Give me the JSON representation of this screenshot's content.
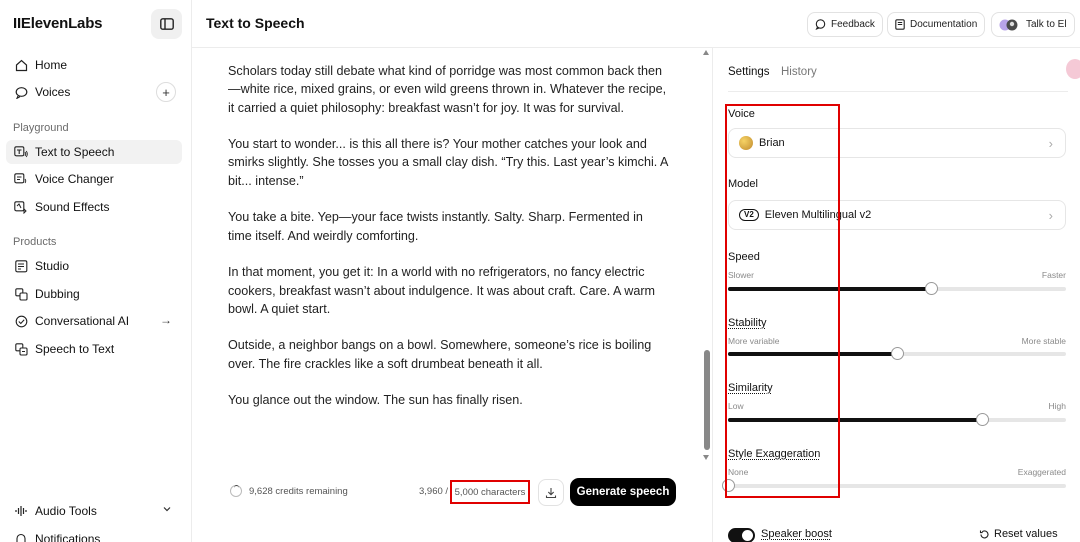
{
  "sidebar": {
    "logo": "IIElevenLabs",
    "nav_top": [
      {
        "label": "Home",
        "icon": "home-icon"
      },
      {
        "label": "Voices",
        "icon": "voices-icon"
      }
    ],
    "section_playground": "Playground",
    "playground": [
      {
        "label": "Text to Speech",
        "icon": "tts-icon",
        "active": true
      },
      {
        "label": "Voice Changer",
        "icon": "voice-changer-icon"
      },
      {
        "label": "Sound Effects",
        "icon": "sound-effects-icon"
      }
    ],
    "section_products": "Products",
    "products": [
      {
        "label": "Studio",
        "icon": "studio-icon"
      },
      {
        "label": "Dubbing",
        "icon": "dubbing-icon"
      },
      {
        "label": "Conversational AI",
        "icon": "conversational-ai-icon"
      },
      {
        "label": "Speech to Text",
        "icon": "speech-to-text-icon"
      }
    ],
    "bottom": [
      {
        "label": "Audio Tools",
        "icon": "audio-tools-icon"
      },
      {
        "label": "Notifications",
        "icon": "bell-icon"
      }
    ]
  },
  "header": {
    "title": "Text to Speech",
    "feedback": "Feedback",
    "documentation": "Documentation",
    "talk": "Talk to El"
  },
  "editor": {
    "paragraphs": [
      "Scholars today still debate what kind of porridge was most common back then—white rice, mixed grains, or even wild greens thrown in. Whatever the recipe, it carried a quiet philosophy: breakfast wasn’t for joy. It was for survival.",
      "You start to wonder... is this all there is? Your mother catches your look and smirks slightly. She tosses you a small clay dish. “Try this. Last year’s kimchi. A bit... intense.”",
      "You take a bite. Yep—your face twists instantly. Salty. Sharp. Fermented in time itself. And weirdly comforting.",
      "In that moment, you get it: In a world with no refrigerators, no fancy electric cookers, breakfast wasn’t about indulgence. It was about craft. Care. A warm bowl. A quiet start.",
      "Outside, a neighbor bangs on a bowl. Somewhere, someone’s rice is boiling over. The fire crackles like a soft drumbeat beneath it all.",
      "You glance out the window. The sun has finally risen."
    ],
    "credits_remaining": "9,628 credits remaining",
    "char_count": "3,960 /",
    "char_limit": "5,000 characters",
    "generate_label": "Generate speech"
  },
  "settings": {
    "tabs": [
      "Settings",
      "History"
    ],
    "voice_label": "Voice",
    "voice_value": "Brian",
    "model_label": "Model",
    "model_badge": "V2",
    "model_value": "Eleven Multilingual v2",
    "sliders": [
      {
        "label": "Speed",
        "min_label": "Slower",
        "max_label": "Faster",
        "value": 0.6
      },
      {
        "label": "Stability",
        "min_label": "More variable",
        "max_label": "More stable",
        "value": 0.5
      },
      {
        "label": "Similarity",
        "min_label": "Low",
        "max_label": "High",
        "value": 0.75
      },
      {
        "label": "Style Exaggeration",
        "min_label": "None",
        "max_label": "Exaggerated",
        "value": 0.0
      }
    ],
    "speaker_boost_label": "Speaker boost",
    "speaker_boost_on": true,
    "reset_label": "Reset values"
  },
  "colors": {
    "accent": "#000000",
    "highlight_box": "#e00000",
    "active_nav_bg": "#f2f2f2"
  }
}
